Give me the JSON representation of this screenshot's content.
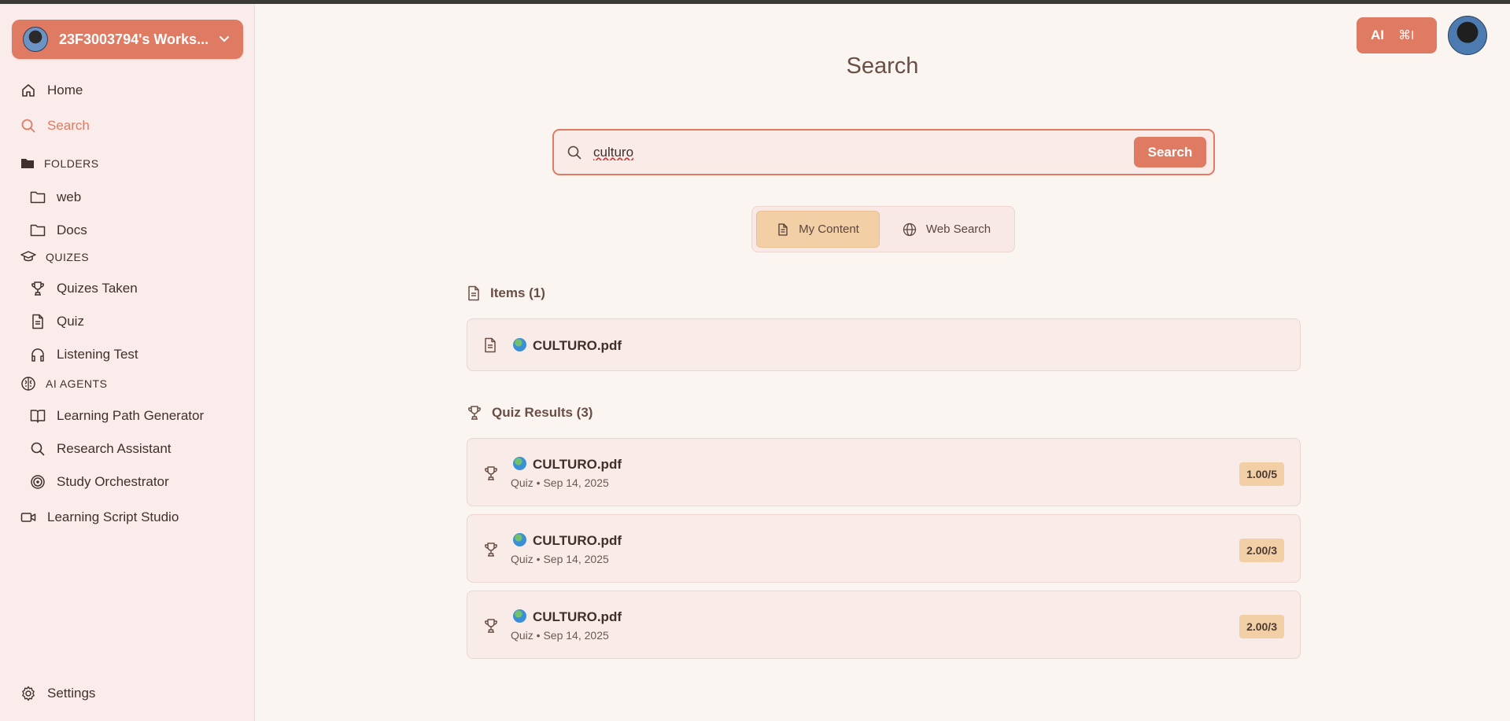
{
  "sidebar": {
    "workspace_name": "23F3003794's Works...",
    "nav": [
      {
        "label": "Home",
        "icon": "home-icon"
      },
      {
        "label": "Search",
        "icon": "search-icon"
      }
    ],
    "folders_header": "FOLDERS",
    "folders": [
      {
        "label": "web",
        "icon": "folder-icon"
      },
      {
        "label": "Docs",
        "icon": "folder-icon"
      }
    ],
    "quizes_header": "QUIZES",
    "quizes": [
      {
        "label": "Quizes Taken",
        "icon": "trophy-icon"
      },
      {
        "label": "Quiz",
        "icon": "document-icon"
      },
      {
        "label": "Listening Test",
        "icon": "headphones-icon"
      }
    ],
    "agents_header": "AI AGENTS",
    "agents": [
      {
        "label": "Learning Path Generator",
        "icon": "book-icon"
      },
      {
        "label": "Research Assistant",
        "icon": "search-icon"
      },
      {
        "label": "Study Orchestrator",
        "icon": "target-icon"
      }
    ],
    "studio": {
      "label": "Learning Script Studio",
      "icon": "video-icon"
    },
    "settings": {
      "label": "Settings",
      "icon": "gear-icon"
    }
  },
  "header": {
    "ai_label": "AI",
    "ai_shortcut": "⌘I"
  },
  "main": {
    "title": "Search",
    "search": {
      "value": "culturo",
      "button": "Search"
    },
    "tabs": [
      {
        "label": "My Content",
        "active": true
      },
      {
        "label": "Web Search",
        "active": false
      }
    ],
    "items_header": "Items (1)",
    "items": [
      {
        "title": "CULTURO.pdf"
      }
    ],
    "quiz_header": "Quiz Results (3)",
    "quiz_results": [
      {
        "title": "CULTURO.pdf",
        "meta": "Quiz • Sep 14, 2025",
        "score": "1.00/5"
      },
      {
        "title": "CULTURO.pdf",
        "meta": "Quiz • Sep 14, 2025",
        "score": "2.00/3"
      },
      {
        "title": "CULTURO.pdf",
        "meta": "Quiz • Sep 14, 2025",
        "score": "2.00/3"
      }
    ]
  },
  "colors": {
    "accent": "#e07b63",
    "sidebar_bg": "#faecea",
    "badge_bg": "#f3cfa6"
  }
}
